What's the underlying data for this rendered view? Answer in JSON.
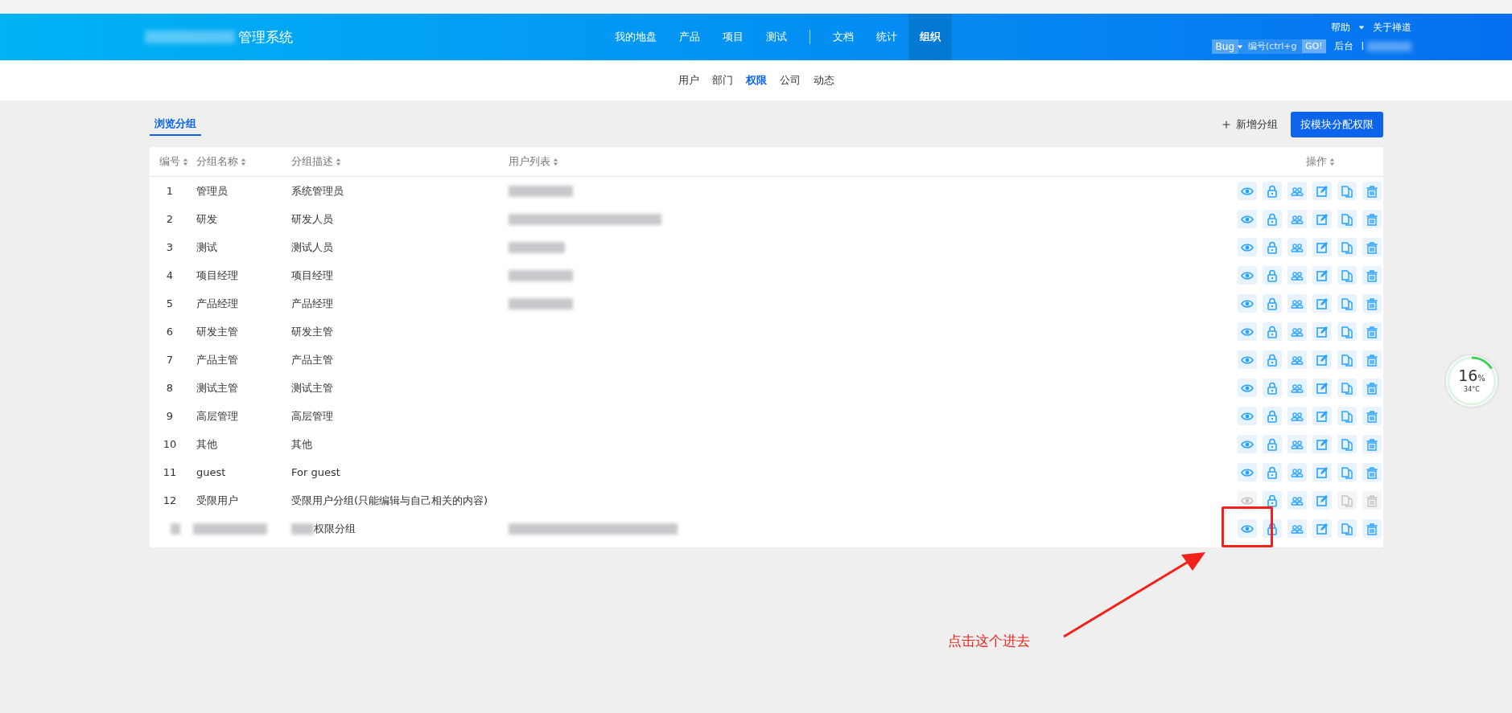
{
  "header": {
    "logo": "管理系统",
    "nav": [
      {
        "kind": "link",
        "label": "我的地盘",
        "selected": false
      },
      {
        "kind": "link",
        "label": "产品",
        "selected": false
      },
      {
        "kind": "link",
        "label": "项目",
        "selected": false
      },
      {
        "kind": "link",
        "label": "测试",
        "selected": false
      },
      {
        "kind": "divider"
      },
      {
        "kind": "link",
        "label": "文档",
        "selected": false
      },
      {
        "kind": "link",
        "label": "统计",
        "selected": false
      },
      {
        "kind": "link",
        "label": "组织",
        "selected": true
      }
    ],
    "help": "帮助",
    "about": "关于禅道",
    "search": {
      "type": "Bug",
      "placeholder": "编号(ctrl+g",
      "button": "GO!"
    },
    "admin": "后台",
    "user": "l"
  },
  "subnav": [
    {
      "label": "用户",
      "selected": false
    },
    {
      "label": "部门",
      "selected": false
    },
    {
      "label": "权限",
      "selected": true
    },
    {
      "label": "公司",
      "selected": false
    },
    {
      "label": "动态",
      "selected": false
    }
  ],
  "page_tab": {
    "label": "浏览分组",
    "selected": true
  },
  "toolbar": {
    "add": "新增分组",
    "assign": "按模块分配权限"
  },
  "table": {
    "columns": [
      "编号",
      "分组名称",
      "分组描述",
      "用户列表",
      "操作"
    ],
    "rows": [
      {
        "id": "1",
        "name": "管理员",
        "description": "系统管理员",
        "users_redacted": true,
        "actions": [
          {
            "kind": "view",
            "disabled": false
          },
          {
            "kind": "lock",
            "disabled": false
          },
          {
            "kind": "members",
            "disabled": false
          },
          {
            "kind": "edit",
            "disabled": false
          },
          {
            "kind": "copy",
            "disabled": false
          },
          {
            "kind": "delete",
            "disabled": false
          }
        ]
      },
      {
        "id": "2",
        "name": "研发",
        "description": "研发人员",
        "users_redacted": true,
        "actions": [
          {
            "kind": "view",
            "disabled": false
          },
          {
            "kind": "lock",
            "disabled": false
          },
          {
            "kind": "members",
            "disabled": false
          },
          {
            "kind": "edit",
            "disabled": false
          },
          {
            "kind": "copy",
            "disabled": false
          },
          {
            "kind": "delete",
            "disabled": false
          }
        ]
      },
      {
        "id": "3",
        "name": "测试",
        "description": "测试人员",
        "users_redacted": true,
        "actions": [
          {
            "kind": "view",
            "disabled": false
          },
          {
            "kind": "lock",
            "disabled": false
          },
          {
            "kind": "members",
            "disabled": false
          },
          {
            "kind": "edit",
            "disabled": false
          },
          {
            "kind": "copy",
            "disabled": false
          },
          {
            "kind": "delete",
            "disabled": false
          }
        ]
      },
      {
        "id": "4",
        "name": "项目经理",
        "description": "项目经理",
        "users_redacted": true,
        "actions": [
          {
            "kind": "view",
            "disabled": false
          },
          {
            "kind": "lock",
            "disabled": false
          },
          {
            "kind": "members",
            "disabled": false
          },
          {
            "kind": "edit",
            "disabled": false
          },
          {
            "kind": "copy",
            "disabled": false
          },
          {
            "kind": "delete",
            "disabled": false
          }
        ]
      },
      {
        "id": "5",
        "name": "产品经理",
        "description": "产品经理",
        "users_redacted": true,
        "actions": [
          {
            "kind": "view",
            "disabled": false
          },
          {
            "kind": "lock",
            "disabled": false
          },
          {
            "kind": "members",
            "disabled": false
          },
          {
            "kind": "edit",
            "disabled": false
          },
          {
            "kind": "copy",
            "disabled": false
          },
          {
            "kind": "delete",
            "disabled": false
          }
        ]
      },
      {
        "id": "6",
        "name": "研发主管",
        "description": "研发主管",
        "users_redacted": false,
        "actions": [
          {
            "kind": "view",
            "disabled": false
          },
          {
            "kind": "lock",
            "disabled": false
          },
          {
            "kind": "members",
            "disabled": false
          },
          {
            "kind": "edit",
            "disabled": false
          },
          {
            "kind": "copy",
            "disabled": false
          },
          {
            "kind": "delete",
            "disabled": false
          }
        ]
      },
      {
        "id": "7",
        "name": "产品主管",
        "description": "产品主管",
        "users_redacted": false,
        "actions": [
          {
            "kind": "view",
            "disabled": false
          },
          {
            "kind": "lock",
            "disabled": false
          },
          {
            "kind": "members",
            "disabled": false
          },
          {
            "kind": "edit",
            "disabled": false
          },
          {
            "kind": "copy",
            "disabled": false
          },
          {
            "kind": "delete",
            "disabled": false
          }
        ]
      },
      {
        "id": "8",
        "name": "测试主管",
        "description": "测试主管",
        "users_redacted": false,
        "actions": [
          {
            "kind": "view",
            "disabled": false
          },
          {
            "kind": "lock",
            "disabled": false
          },
          {
            "kind": "members",
            "disabled": false
          },
          {
            "kind": "edit",
            "disabled": false
          },
          {
            "kind": "copy",
            "disabled": false
          },
          {
            "kind": "delete",
            "disabled": false
          }
        ]
      },
      {
        "id": "9",
        "name": "高层管理",
        "description": "高层管理",
        "users_redacted": false,
        "actions": [
          {
            "kind": "view",
            "disabled": false
          },
          {
            "kind": "lock",
            "disabled": false
          },
          {
            "kind": "members",
            "disabled": false
          },
          {
            "kind": "edit",
            "disabled": false
          },
          {
            "kind": "copy",
            "disabled": false
          },
          {
            "kind": "delete",
            "disabled": false
          }
        ]
      },
      {
        "id": "10",
        "name": "其他",
        "description": "其他",
        "users_redacted": false,
        "actions": [
          {
            "kind": "view",
            "disabled": false
          },
          {
            "kind": "lock",
            "disabled": false
          },
          {
            "kind": "members",
            "disabled": false
          },
          {
            "kind": "edit",
            "disabled": false
          },
          {
            "kind": "copy",
            "disabled": false
          },
          {
            "kind": "delete",
            "disabled": false
          }
        ]
      },
      {
        "id": "11",
        "name": "guest",
        "description": "For guest",
        "users_redacted": false,
        "actions": [
          {
            "kind": "view",
            "disabled": false
          },
          {
            "kind": "lock",
            "disabled": false
          },
          {
            "kind": "members",
            "disabled": false
          },
          {
            "kind": "edit",
            "disabled": false
          },
          {
            "kind": "copy",
            "disabled": false
          },
          {
            "kind": "delete",
            "disabled": false
          }
        ]
      },
      {
        "id": "12",
        "name": "受限用户",
        "description": "受限用户分组(只能编辑与自己相关的内容)",
        "users_redacted": false,
        "actions": [
          {
            "kind": "view",
            "disabled": true
          },
          {
            "kind": "lock",
            "disabled": false
          },
          {
            "kind": "members",
            "disabled": false
          },
          {
            "kind": "edit",
            "disabled": false
          },
          {
            "kind": "copy",
            "disabled": true
          },
          {
            "kind": "delete",
            "disabled": true
          }
        ]
      },
      {
        "id_redacted": true,
        "name_redacted": true,
        "description_redacted_prefix": true,
        "description": "权限分组",
        "users_redacted": true,
        "actions": [
          {
            "kind": "view",
            "disabled": false
          },
          {
            "kind": "lock",
            "disabled": false
          },
          {
            "kind": "members",
            "disabled": false
          },
          {
            "kind": "edit",
            "disabled": false
          },
          {
            "kind": "copy",
            "disabled": false
          },
          {
            "kind": "delete",
            "disabled": false
          }
        ]
      }
    ]
  },
  "widget": {
    "level": 0.16,
    "value": "16",
    "unit": "%",
    "temperature": "34°C"
  },
  "annotation": {
    "text": "点击这个进去"
  }
}
